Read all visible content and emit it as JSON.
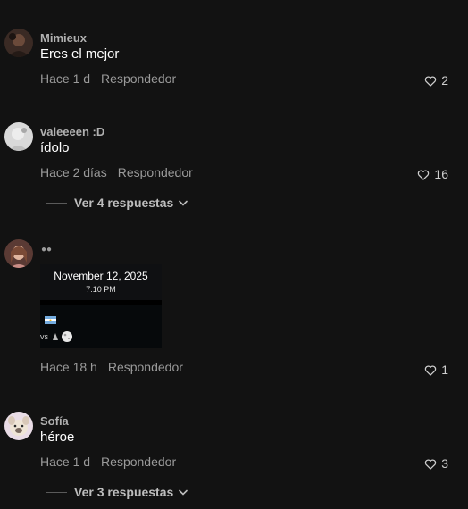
{
  "comments": [
    {
      "username": "Mimieux",
      "text": "Eres el mejor",
      "time": "Hace 1 d",
      "reply_label": "Respondedor",
      "likes": "2"
    },
    {
      "username": "valeeeen :D",
      "text": "ídolo",
      "time": "Hace 2 días",
      "reply_label": "Respondedor",
      "likes": "16",
      "replies_toggle": "Ver 4 respuestas"
    },
    {
      "username_icon": "paw-print-icon",
      "image": {
        "date": "November 12, 2025",
        "time": "7:10 PM",
        "fragment": "vs"
      },
      "time": "Hace 18 h",
      "reply_label": "Respondedor",
      "likes": "1"
    },
    {
      "username": "Sofía",
      "text": "héroe",
      "time": "Hace 1 d",
      "reply_label": "Respondedor",
      "likes": "3",
      "replies_toggle": "Ver 3 respuestas"
    }
  ],
  "colors": {
    "background": "#121212",
    "username": "#b0b0b0",
    "meta": "#9a9a9a"
  }
}
